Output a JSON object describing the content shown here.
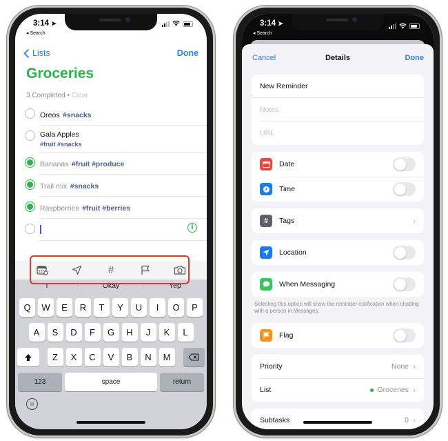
{
  "status_bar": {
    "time": "3:14",
    "back_label": "◂ Search"
  },
  "left": {
    "nav": {
      "back_label": "Lists",
      "done_label": "Done"
    },
    "list_title": "Groceries",
    "completed_text": "3 Completed",
    "clear_label": "Clear",
    "items": [
      {
        "name": "Oreos",
        "tags": "#snacks",
        "subtags": "",
        "completed": false
      },
      {
        "name": "Gala Apples",
        "tags": "",
        "subtags": "#fruit #snacks",
        "completed": false
      },
      {
        "name": "Bananas",
        "tags": "#fruit #produce",
        "subtags": "",
        "completed": true
      },
      {
        "name": "Trail mix",
        "tags": "#snacks",
        "subtags": "",
        "completed": true
      },
      {
        "name": "Raspberries",
        "tags": "#fruit #berries",
        "subtags": "",
        "completed": true
      }
    ],
    "toolbar": [
      "calendar-clock-icon",
      "location-arrow-icon",
      "hashtag-icon",
      "flag-icon",
      "camera-icon"
    ],
    "suggestions": [
      "I",
      "Okay",
      "Yep"
    ],
    "keyboard": {
      "row1": [
        "Q",
        "W",
        "E",
        "R",
        "T",
        "Y",
        "U",
        "I",
        "O",
        "P"
      ],
      "row2": [
        "A",
        "S",
        "D",
        "F",
        "G",
        "H",
        "J",
        "K",
        "L"
      ],
      "row3": [
        "Z",
        "X",
        "C",
        "V",
        "B",
        "N",
        "M"
      ],
      "numbers_label": "123",
      "space_label": "space",
      "return_label": "return"
    }
  },
  "right": {
    "nav": {
      "cancel_label": "Cancel",
      "title": "Details",
      "done_label": "Done"
    },
    "title_field": "New Reminder",
    "notes_placeholder": "Notes",
    "url_placeholder": "URL",
    "date_label": "Date",
    "time_label": "Time",
    "tags_label": "Tags",
    "location_label": "Location",
    "messaging_label": "When Messaging",
    "messaging_footnote": "Selecting this option will show the reminder notification when chatting with a person in Messages.",
    "flag_label": "Flag",
    "priority_label": "Priority",
    "priority_value": "None",
    "list_label": "List",
    "list_value": "Groceries",
    "subtasks_label": "Subtasks",
    "subtasks_value": "0",
    "toggles": {
      "date": false,
      "time": false,
      "location": false,
      "messaging": false,
      "flag": false
    }
  },
  "colors": {
    "accent_blue": "#2f7cf6",
    "list_green": "#2fb34d",
    "tag_blue": "#4a5f9c",
    "highlight_red": "#d8392c",
    "date_icon": "#f0453a",
    "time_icon": "#1a7cf3",
    "tags_icon": "#5d6168",
    "location_icon": "#1a7cf3",
    "messaging_icon": "#34c759",
    "flag_icon": "#f7941d"
  }
}
